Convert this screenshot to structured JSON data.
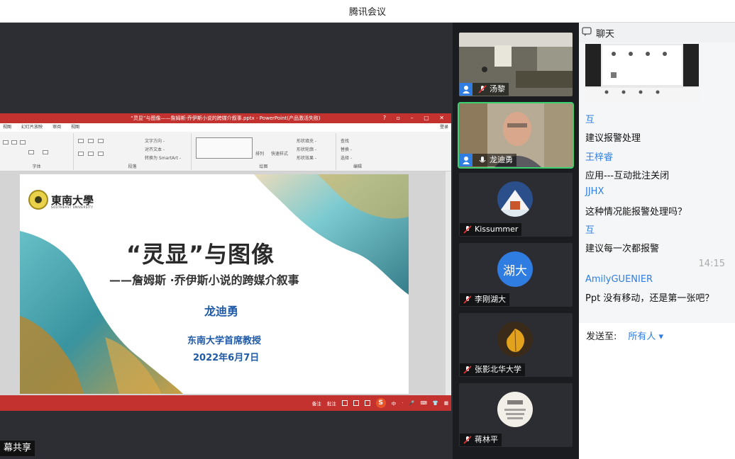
{
  "app": {
    "title": "腾讯会议"
  },
  "share": {
    "badge": "幕共享"
  },
  "ppt": {
    "window_title": "“灵显”与图像——詹姆斯·乔伊斯小说的跨媒介叙事.pptx - PowerPoint(产品激活失败)",
    "window_buttons": "? ▫ – ▢ ✕",
    "menu": [
      "视图",
      "幻灯片放映",
      "审阅",
      "视图"
    ],
    "login_label": "登录",
    "ribbon": {
      "groups": [
        "字体",
        "段落",
        "绘图",
        "编辑"
      ],
      "items": {
        "text_direction": "文字方向 -",
        "align_text": "对齐文本 -",
        "convert_smartart": "转换为 SmartArt -",
        "arrange": "排列",
        "quick_styles": "快速样式",
        "shape_fill": "形状填充 -",
        "shape_outline": "形状轮廓 -",
        "shape_effects": "形状效果 -",
        "find": "查找",
        "replace": "替换 -",
        "select": "选择 -"
      }
    },
    "slide": {
      "logo_text": "東南大學",
      "logo_sub": "SOUTHEAST UNIVERSITY",
      "title": "“灵显”与图像",
      "subtitle": "——詹姆斯 ·乔伊斯小说的跨媒介叙事",
      "author": "龙迪勇",
      "affiliation": "东南大学首席教授",
      "date": "2022年6月7日"
    },
    "status": {
      "notes": "备注",
      "comments": "批注",
      "ime_items": [
        "中",
        "·",
        "🎤",
        "⌨",
        "👕",
        "▦"
      ]
    }
  },
  "participants": [
    {
      "name": "汤黎",
      "host": true,
      "mic": "muted"
    },
    {
      "name": "龙迪勇",
      "host": true,
      "mic": "on",
      "active": true
    },
    {
      "name": "Kissummer",
      "host": false,
      "mic": "muted"
    },
    {
      "name": "李刚湖大",
      "host": false,
      "mic": "muted",
      "avatar_text": "湖大"
    },
    {
      "name": "张影北华大学",
      "host": false,
      "mic": "muted"
    },
    {
      "name": "蒋林平",
      "host": false,
      "mic": "muted"
    }
  ],
  "chat": {
    "header": "聊天",
    "messages": [
      {
        "sender": "互",
        "text": "建议报警处理"
      },
      {
        "sender": "王梓睿",
        "text": "应用---互动批注关闭"
      },
      {
        "sender": "JJHX",
        "text": "这种情况能报警处理吗？"
      },
      {
        "sender": "互",
        "text": "建议每一次都报警"
      },
      {
        "time": "14:15"
      },
      {
        "sender": "AmilyGUENIER",
        "text": "Ppt 没有移动，还是第一张吧？"
      }
    ],
    "send_to_label": "发送至:",
    "send_to_value": "所有人 ▾"
  },
  "colors": {
    "active_speaker": "#3bd16f",
    "accent": "#2f7de1",
    "ppt_red": "#c3322e"
  }
}
